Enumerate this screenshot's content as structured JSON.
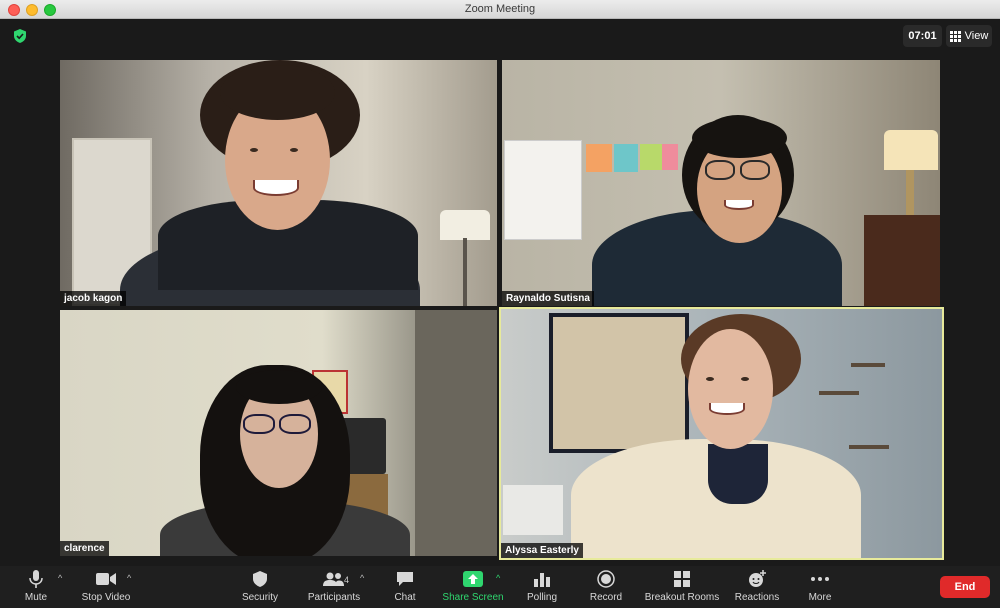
{
  "window": {
    "title": "Zoom Meeting"
  },
  "meeting": {
    "timer": "07:01",
    "view_label": "View",
    "participants": [
      {
        "name": "jacob kagon",
        "active_speaker": false
      },
      {
        "name": "Raynaldo Sutisna",
        "active_speaker": false
      },
      {
        "name": "clarence",
        "active_speaker": false
      },
      {
        "name": "Alyssa Easterly",
        "active_speaker": true
      }
    ]
  },
  "toolbar": {
    "mute": "Mute",
    "stop_video": "Stop Video",
    "security": "Security",
    "participants": "Participants",
    "participants_count": "4",
    "chat": "Chat",
    "share_screen": "Share Screen",
    "polling": "Polling",
    "record": "Record",
    "breakout_rooms": "Breakout Rooms",
    "reactions": "Reactions",
    "more": "More",
    "end": "End"
  },
  "colors": {
    "active_speaker_border": "#e7ea9b",
    "share_screen": "#2fd66f",
    "end_button": "#e02a2a",
    "shield": "#2fd66f"
  }
}
